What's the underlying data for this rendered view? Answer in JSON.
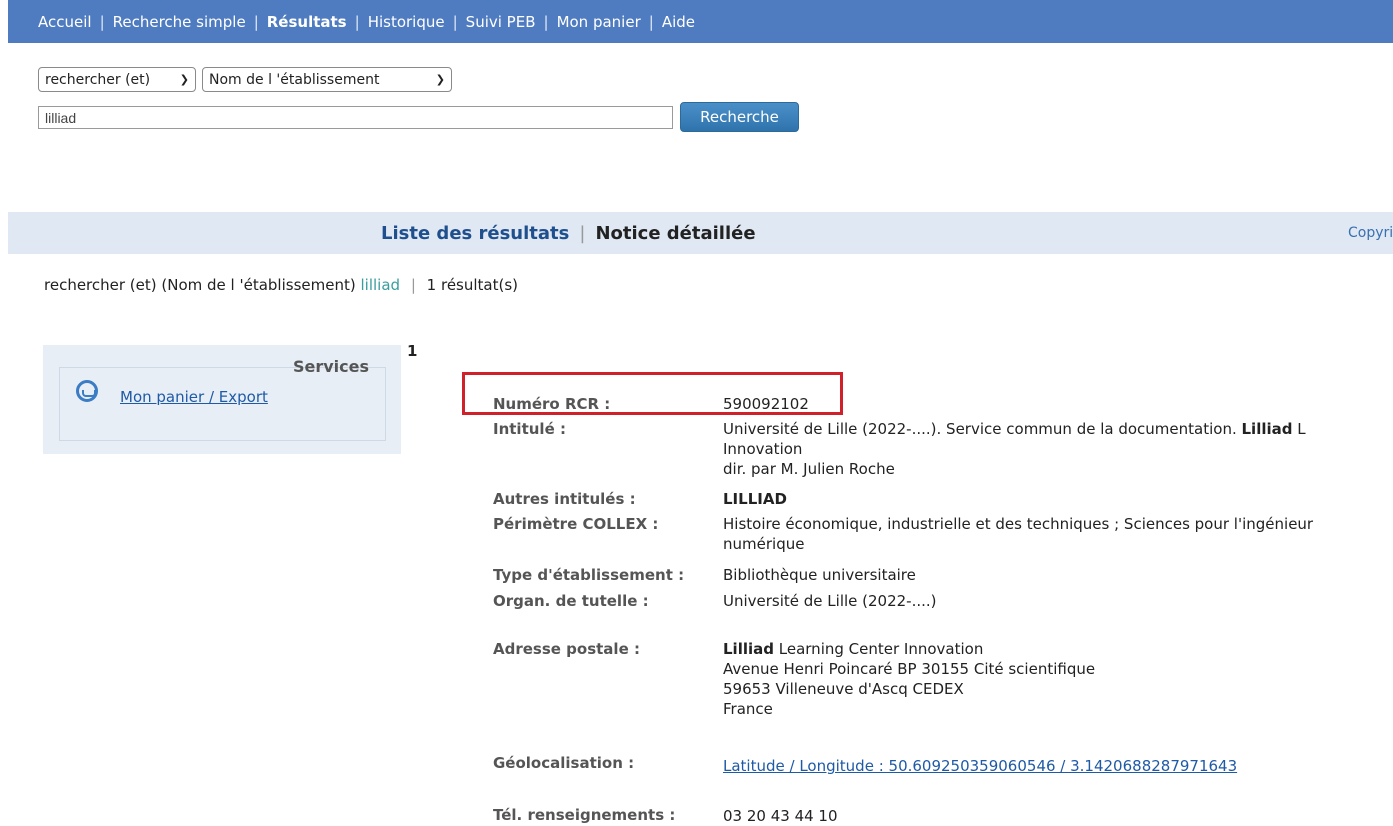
{
  "nav": {
    "items": [
      "Accueil",
      "Recherche simple",
      "Résultats",
      "Historique",
      "Suivi PEB",
      "Mon panier",
      "Aide"
    ]
  },
  "search": {
    "operator": "rechercher (et)",
    "field": "Nom de l 'établissement",
    "value": "lilliad",
    "button": "Recherche"
  },
  "results_bar": {
    "tab_list": "Liste des résultats",
    "tab_detail": "Notice détaillée",
    "copyright": "Copyri"
  },
  "summary": {
    "prefix": "rechercher (et) (Nom de l 'établissement)",
    "term": "lilliad",
    "count": "1 résultat(s)"
  },
  "services": {
    "title": "Services",
    "basket_link": "Mon panier / Export"
  },
  "record": {
    "number": "1",
    "rcr_label": "Numéro RCR :",
    "rcr_value": "590092102",
    "intitule_label": "Intitulé :",
    "intitule_line1_prefix": "Université de Lille (2022-....). Service commun de la documentation.",
    "intitule_line1_bold": "Lilliad",
    "intitule_line1_suffix": "L",
    "intitule_line2": "Innovation",
    "intitule_line3": "dir. par M. Julien Roche",
    "autres_label": "Autres intitulés :",
    "autres_value": "LILLIAD",
    "collex_label": "Périmètre COLLEX :",
    "collex_line1": "Histoire économique, industrielle et des techniques ; Sciences pour l'ingénieur",
    "collex_line2": "numérique",
    "type_label": "Type d'établissement :",
    "type_value": "Bibliothèque universitaire",
    "tutelle_label": "Organ. de tutelle :",
    "tutelle_value": "Université de Lille (2022-....)",
    "adresse_label": "Adresse postale :",
    "adresse_line1_bold": "Lilliad",
    "adresse_line1_rest": "Learning Center Innovation",
    "adresse_line2": "Avenue Henri Poincaré BP 30155 Cité scientifique",
    "adresse_line3": "59653 Villeneuve d'Ascq CEDEX",
    "adresse_line4": "France",
    "geo_label": "Géolocalisation :",
    "geo_value": "Latitude / Longitude : 50.609250359060546 / 3.1420688287971643",
    "tel_label": "Tél. renseignements :",
    "tel_value": "03 20 43 44 10"
  }
}
